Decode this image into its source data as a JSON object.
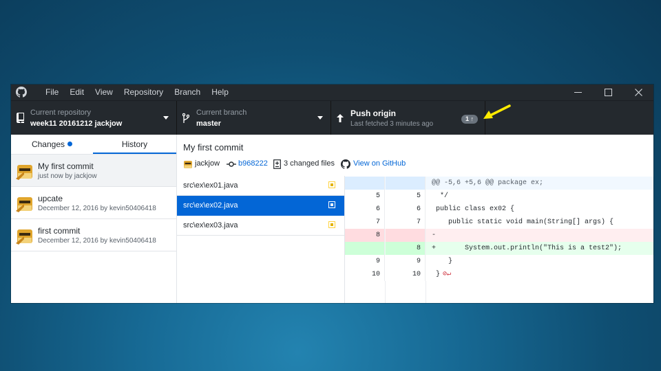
{
  "menu": [
    "File",
    "Edit",
    "View",
    "Repository",
    "Branch",
    "Help"
  ],
  "toolbar": {
    "repo_label": "Current repository",
    "repo_name": "week11 20161212 jackjow",
    "branch_label": "Current branch",
    "branch_name": "master",
    "push_label": "Push origin",
    "push_sub": "Last fetched 3 minutes ago",
    "push_badge": "1 ↑"
  },
  "tabs": {
    "changes": "Changes",
    "history": "History"
  },
  "history": [
    {
      "title": "My first commit",
      "meta": "just now by jackjow"
    },
    {
      "title": "upcate",
      "meta": "December 12, 2016 by kevin50406418"
    },
    {
      "title": "first commit",
      "meta": "December 12, 2016 by kevin50406418"
    }
  ],
  "commit": {
    "title": "My first commit",
    "author": "jackjow",
    "sha": "b968222",
    "changed": "3 changed files",
    "view_link": "View on GitHub"
  },
  "files": [
    {
      "name": "src\\ex\\ex01.java"
    },
    {
      "name": "src\\ex\\ex02.java"
    },
    {
      "name": "src\\ex\\ex03.java"
    }
  ],
  "diff": {
    "hunk": "@@ -5,6 +5,6 @@ package ex;",
    "rows": [
      {
        "old": "5",
        "new": "5",
        "text": "  */"
      },
      {
        "old": "6",
        "new": "6",
        "text": " public class ex02 {"
      },
      {
        "old": "7",
        "new": "7",
        "text": "    public static void main(String[] args) {"
      },
      {
        "old": "8",
        "new": "",
        "text": "-"
      },
      {
        "old": "",
        "new": "8",
        "text": "+       System.out.println(\"This is a test2\");"
      },
      {
        "old": "9",
        "new": "9",
        "text": "    }"
      },
      {
        "old": "10",
        "new": "10",
        "text": " }"
      }
    ],
    "noeol": "⊘↵"
  },
  "colors": {
    "accent": "#0366d6",
    "titlebar": "#24292e",
    "arrow": "#ffeb00"
  }
}
